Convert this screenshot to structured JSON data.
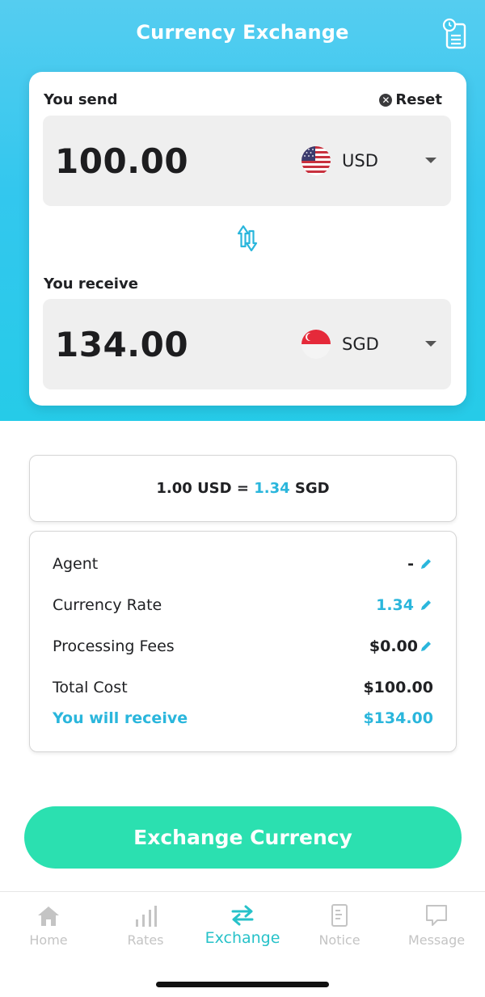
{
  "header": {
    "title": "Currency Exchange",
    "history_icon": "history-list-icon"
  },
  "converter": {
    "send_label": "You send",
    "reset_label": "Reset",
    "send_amount": "100.00",
    "send_currency": "USD",
    "send_flag": "us-flag-icon",
    "receive_label": "You receive",
    "receive_amount": "134.00",
    "receive_currency": "SGD",
    "receive_flag": "sg-flag-icon",
    "swap_icon": "swap-vertical-icon"
  },
  "rate_banner": {
    "prefix": "1.00 USD = ",
    "rate": "1.34",
    "suffix": " SGD"
  },
  "details": {
    "agent_label": "Agent",
    "agent_value": "-",
    "rate_label": "Currency Rate",
    "rate_value": "1.34",
    "fees_label": "Processing Fees",
    "fees_value": "$0.00",
    "total_label": "Total Cost",
    "total_value": "$100.00",
    "receive_label": "You will receive",
    "receive_value": "$134.00"
  },
  "cta": {
    "label": "Exchange Currency"
  },
  "tabbar": {
    "items": [
      {
        "label": "Home",
        "icon": "home-icon",
        "active": false
      },
      {
        "label": "Rates",
        "icon": "bar-chart-icon",
        "active": false
      },
      {
        "label": "Exchange",
        "icon": "exchange-arrows-icon",
        "active": true
      },
      {
        "label": "Notice",
        "icon": "document-icon",
        "active": false
      },
      {
        "label": "Message",
        "icon": "chat-bubble-icon",
        "active": false
      }
    ]
  },
  "colors": {
    "header_gradient_top": "#55cdf0",
    "header_gradient_bottom": "#26cbe8",
    "accent_blue": "#2ab6dc",
    "cta_green": "#2be0b0",
    "tab_active": "#27c2c9",
    "tab_inactive": "#c4c4c4"
  }
}
